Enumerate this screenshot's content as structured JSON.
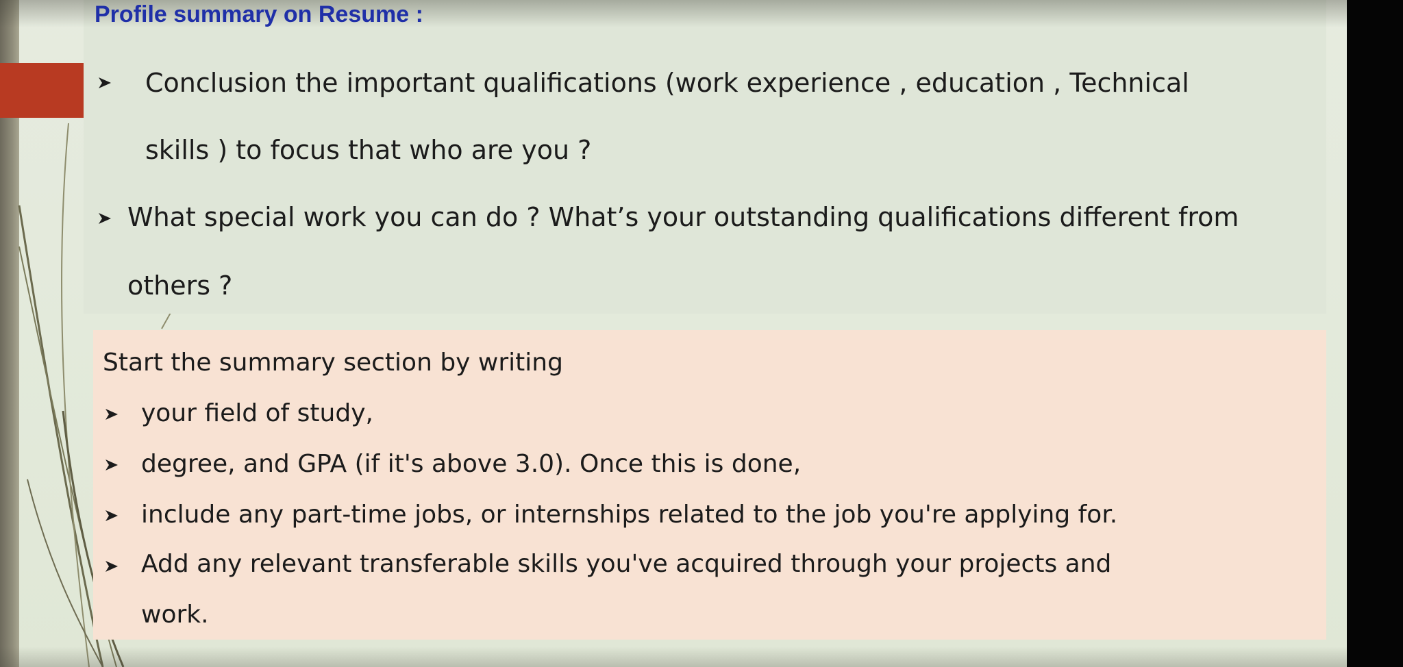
{
  "slide": {
    "title": "Profile summary on Resume :",
    "top_section": {
      "bullet1_line1": "Conclusion the important qualifications (work experience , education , Technical",
      "bullet1_line2": "skills ) to focus that who are you ?",
      "bullet2_line1": "What special work you can do ? What’s your outstanding qualifications different from",
      "bullet2_line2": "others ?"
    },
    "bottom_section": {
      "intro": "Start the summary section by writing",
      "items": [
        "your field of study,",
        "degree, and GPA (if it's above 3.0). Once this is done,",
        "include any part-time jobs, or internships related to the job you're applying for.",
        "Add any relevant transferable skills you've acquired through your projects and"
      ],
      "last_continuation": "work."
    }
  },
  "bullet_icon": "arrow-right-icon",
  "colors": {
    "title": "#1f2fa8",
    "accent": "#b83a22",
    "top_panel": "#dfe6d8",
    "bottom_panel": "#f8e2d3",
    "background": "#e3eadb",
    "right_bar": "#050505"
  }
}
